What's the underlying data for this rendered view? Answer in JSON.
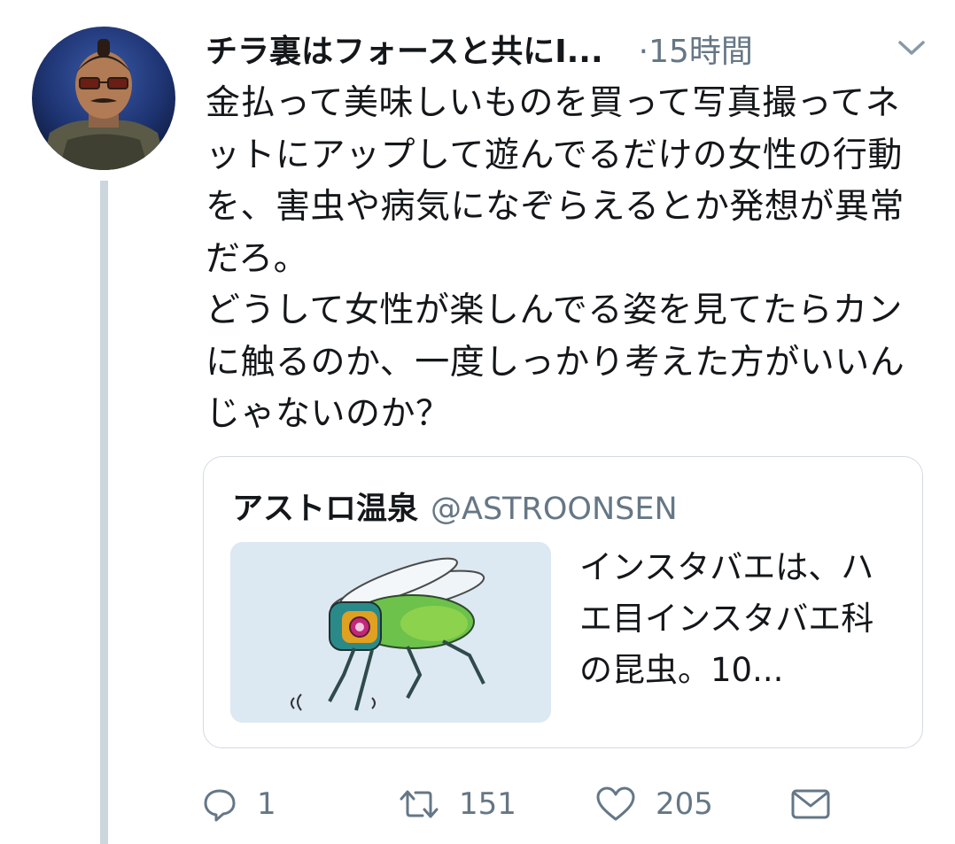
{
  "tweet": {
    "display_name": "チラ裏はフォースと共にI...",
    "time": "·15時間",
    "text": "金払って美味しいものを買って写真撮ってネットにアップして遊んでるだけの女性の行動を、害虫や病気になぞらえるとか発想が異常だろ。\nどうして女性が楽しんでる姿を見てたらカンに触るのか、一度しっかり考えた方がいいんじゃないのか？"
  },
  "quote": {
    "name": "アストロ温泉",
    "handle": "@ASTROONSEN",
    "text": "インスタバエは、ハエ目インスタバエ科の昆虫。10..."
  },
  "actions": {
    "reply_count": "1",
    "retweet_count": "151",
    "like_count": "205"
  },
  "icons": {
    "caret": "chevron-down-icon",
    "reply": "reply-icon",
    "retweet": "retweet-icon",
    "like": "heart-icon",
    "dm": "envelope-icon"
  },
  "colors": {
    "text": "#14171a",
    "secondary": "#657786",
    "border": "#d2dbe1",
    "thread_line": "#ccd6dd"
  }
}
